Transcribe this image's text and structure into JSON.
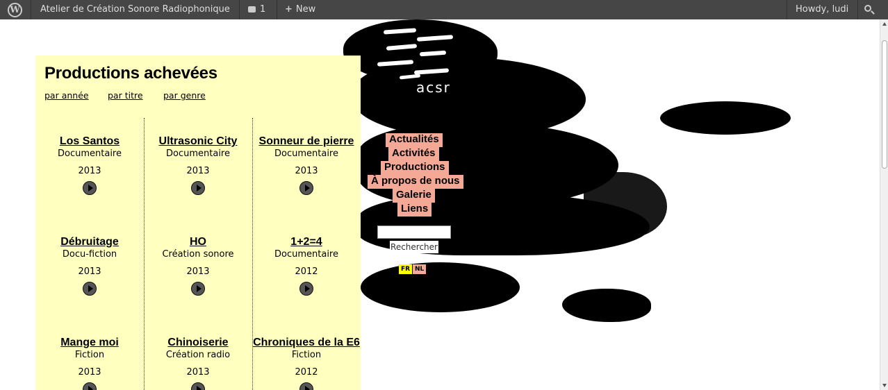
{
  "admin_bar": {
    "site_name": "Atelier de Création Sonore Radiophonique",
    "comments_count": "1",
    "new_label": "New",
    "howdy": "Howdy, ludi",
    "icons": {
      "logo": "wordpress-icon",
      "comment": "comment-icon",
      "new": "plus-icon",
      "search": "search-icon"
    }
  },
  "logo": {
    "text": "acsr"
  },
  "panel": {
    "title": "Productions achevées",
    "sort_links": [
      "par année",
      "par titre",
      "par genre"
    ]
  },
  "productions": [
    {
      "title": "Los Santos",
      "genre": "Documentaire",
      "year": "2013"
    },
    {
      "title": "Ultrasonic City",
      "genre": "Documentaire",
      "year": "2013"
    },
    {
      "title": "Sonneur de pierre",
      "genre": "Documentaire",
      "year": "2013"
    },
    {
      "title": "Débruitage",
      "genre": "Docu-fiction",
      "year": "2013"
    },
    {
      "title": "HO",
      "genre": "Création sonore",
      "year": "2013"
    },
    {
      "title": "1+2=4",
      "genre": "Documentaire",
      "year": "2012"
    },
    {
      "title": "Mange moi",
      "genre": "Fiction",
      "year": "2013"
    },
    {
      "title": "Chinoiserie",
      "genre": "Création radio",
      "year": "2013"
    },
    {
      "title": "Chroniques de la E6",
      "genre": "Fiction",
      "year": "2012"
    }
  ],
  "nav": [
    "Actualités",
    "Activités",
    "Productions",
    "À propos de nous",
    "Galerie",
    "Liens"
  ],
  "search": {
    "button": "Rechercher",
    "value": ""
  },
  "languages": [
    {
      "code": "FR",
      "color": "#ffff00"
    },
    {
      "code": "NL",
      "color": "#f4a896"
    }
  ],
  "colors": {
    "panel_bg": "#ffffc0",
    "nav_bg": "#f4a896",
    "admin_bar": "#464646"
  }
}
